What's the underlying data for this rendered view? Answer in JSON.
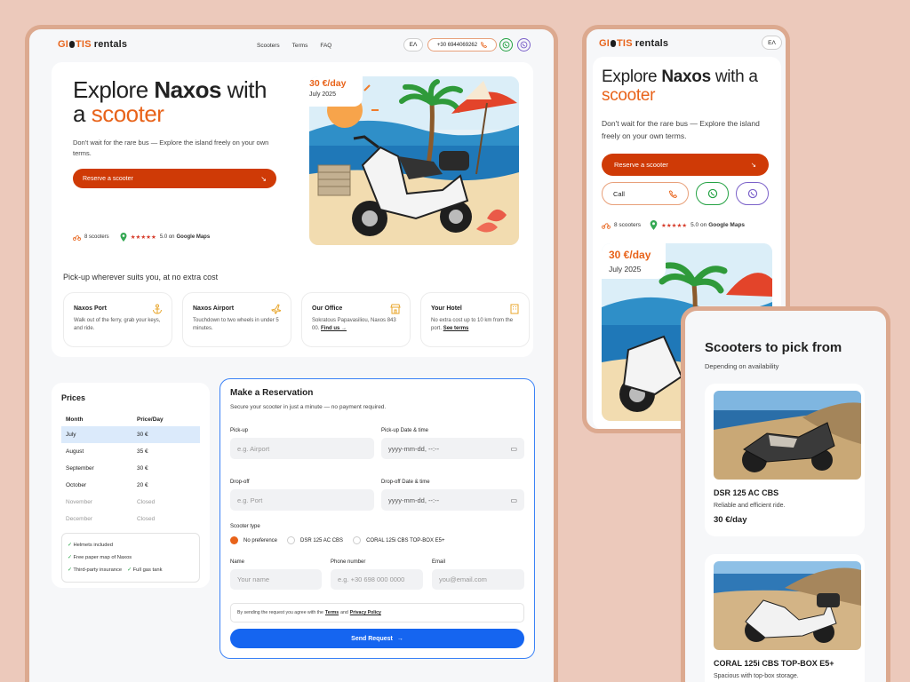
{
  "brand": {
    "logo_a": "GI",
    "logo_b": "TIS",
    "logo_c": "rentals"
  },
  "nav": {
    "scooters": "Scooters",
    "terms": "Terms",
    "faq": "FAQ",
    "lang": "EΛ",
    "phone": "+30 6944069262"
  },
  "hero": {
    "title_pre": "Explore ",
    "title_bold": "Naxos",
    "title_mid": " with",
    "title_pre2": "a ",
    "title_accent": "scooter",
    "subtitle": "Don't wait for the rare bus — Explore the island freely on your own terms.",
    "cta": "Reserve a scooter",
    "stats_scooters": "8 scooters",
    "stars": "★★★★★",
    "rating": "5.0 on",
    "rating_src": "Google Maps",
    "price": "30 €/day",
    "price_period": "July 2025"
  },
  "pickup": {
    "heading": "Pick-up wherever suits you, at no extra cost",
    "items": [
      {
        "title": "Naxos Port",
        "text": "Walk out of the ferry, grab your keys, and ride.",
        "link": ""
      },
      {
        "title": "Naxos Airport",
        "text": "Touchdown to two wheels in under 5 minutes.",
        "link": ""
      },
      {
        "title": "Our Office",
        "text": "Sokratous Papavasiliou, Naxos 843 00.",
        "link": "Find us →"
      },
      {
        "title": "Your Hotel",
        "text": "No extra cost up to 10 km from the port.",
        "link": "See terms"
      }
    ]
  },
  "prices": {
    "heading": "Prices",
    "col_month": "Month",
    "col_price": "Price/Day",
    "rows": [
      {
        "month": "July",
        "price": "30 €"
      },
      {
        "month": "August",
        "price": "35 €"
      },
      {
        "month": "September",
        "price": "30 €"
      },
      {
        "month": "October",
        "price": "20 €"
      },
      {
        "month": "November",
        "price": "Closed"
      },
      {
        "month": "December",
        "price": "Closed"
      }
    ],
    "inc1": "Helmets included",
    "inc2": "Free paper map of Naxos",
    "inc3": "Third-party insurance",
    "inc4": "Full gas tank"
  },
  "reservation": {
    "heading": "Make a Reservation",
    "sub": "Secure your scooter in just a minute — no payment required.",
    "pickup_label": "Pick-up",
    "pickup_ph": "e.g. Airport",
    "pickup_dt_label": "Pick-up Date & time",
    "dt_ph": "yyyy-mm-dd, --:--",
    "dropoff_label": "Drop-off",
    "dropoff_ph": "e.g. Port",
    "dropoff_dt_label": "Drop-off Date & time",
    "type_label": "Scooter type",
    "type_opt1": "No preference",
    "type_opt2": "DSR 125 AC CBS",
    "type_opt3": "CORAL 125i CBS TOP-BOX E5+",
    "name_label": "Name",
    "name_ph": "Your name",
    "phone_label": "Phone number",
    "phone_ph": "e.g. +30 698 000 0000",
    "email_label": "Email",
    "email_ph": "you@email.com",
    "terms_pre": "By sending the request you agree with the",
    "terms_link": "Terms",
    "terms_and": "and",
    "privacy_link": "Privacy Policy",
    "send": "Send Request"
  },
  "mobile": {
    "title_pre": "Explore ",
    "title_bold": "Naxos",
    "title_mid": " with a",
    "title_accent": "scooter",
    "subtitle": "Don't wait for the rare bus — Explore the island freely on your own terms.",
    "cta": "Reserve a scooter",
    "call": "Call",
    "stats_scooters": "8 scooters",
    "stars": "★★★★★",
    "rating": "5.0 on",
    "rating_src": "Google Maps",
    "price": "30 €/day",
    "price_period": "July 2025",
    "lang": "EΛ"
  },
  "picker": {
    "heading": "Scooters to pick from",
    "sub": "Depending on availability",
    "items": [
      {
        "name": "DSR 125 AC CBS",
        "desc": "Reliable and efficient ride.",
        "price": "30 €/day"
      },
      {
        "name": "CORAL 125i CBS TOP-BOX E5+",
        "desc": "Spacious with top-box storage."
      }
    ]
  },
  "colors": {
    "accent": "#e8631a",
    "cta": "#cf3a06",
    "send": "#1565f0",
    "bg": "#ecc9bb",
    "whatsapp": "#25a244",
    "viber": "#7b61c9"
  }
}
